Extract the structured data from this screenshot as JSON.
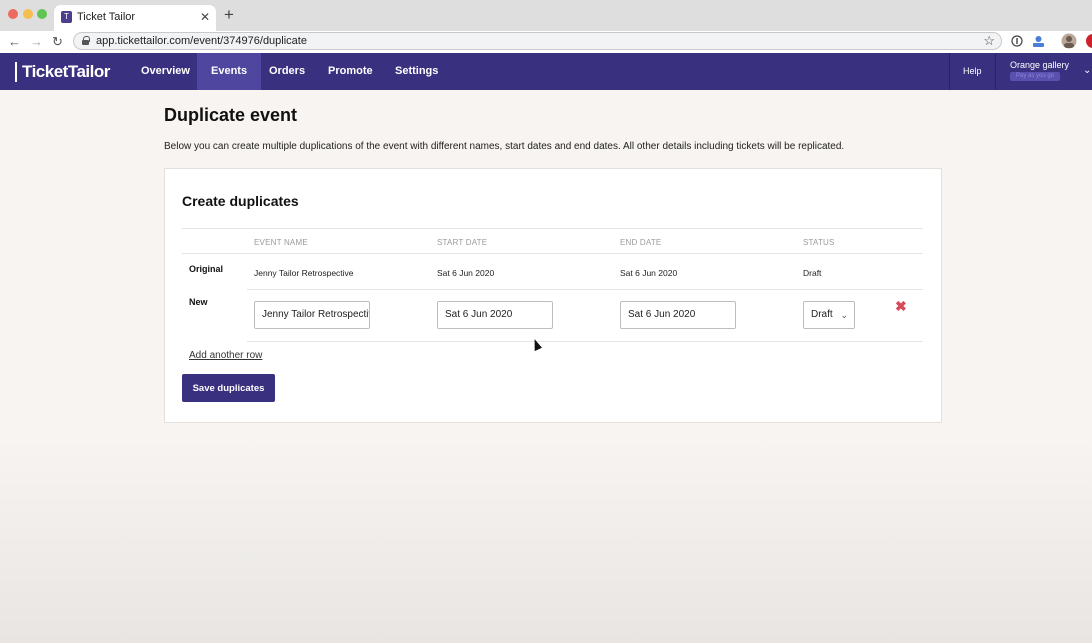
{
  "browser": {
    "tab_title": "Ticket Tailor",
    "tab_favicon": "T",
    "new_tab_icon": "+",
    "close_tab_icon": "✕",
    "url": "app.tickettailor.com/event/374976/duplicate",
    "back_icon": "←",
    "forward_icon": "→",
    "reload_icon": "↻",
    "bookmark_icon": "☆"
  },
  "appnav": {
    "logo_text": "TicketTailor",
    "items": [
      {
        "label": "Overview"
      },
      {
        "label": "Events"
      },
      {
        "label": "Orders"
      },
      {
        "label": "Promote"
      },
      {
        "label": "Settings"
      }
    ],
    "help_label": "Help",
    "account_name": "Orange gallery",
    "account_plan": "Pay as you go",
    "account_chevron": "⌄"
  },
  "page": {
    "title": "Duplicate event",
    "intro": "Below you can create multiple duplications of the event with different names, start dates and end dates. All other details including tickets will be replicated."
  },
  "card": {
    "title": "Create duplicates",
    "columns": [
      "EVENT NAME",
      "START DATE",
      "END DATE",
      "STATUS"
    ],
    "original": {
      "label": "Original",
      "event_name": "Jenny Tailor Retrospective",
      "start_date": "Sat 6 Jun 2020",
      "end_date": "Sat 6 Jun 2020",
      "status": "Draft"
    },
    "new_row": {
      "label": "New",
      "event_name": "Jenny Tailor Retrospective",
      "start_date": "Sat 6 Jun 2020",
      "end_date": "Sat 6 Jun 2020",
      "status": "Draft",
      "remove_icon": "✖"
    },
    "add_row_label": "Add another row",
    "save_label": "Save duplicates"
  },
  "colors": {
    "brand": "#3a3080",
    "danger": "#d84a5a"
  }
}
